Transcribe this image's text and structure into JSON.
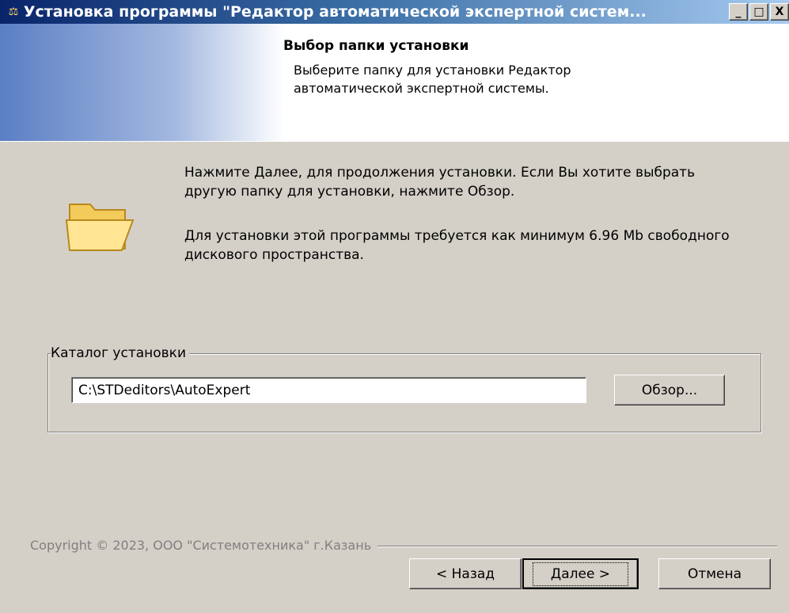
{
  "window": {
    "title": "Установка программы \"Редактор автоматической экспертной систем...",
    "icon": "scales-icon",
    "controls": {
      "minimize": "_",
      "maximize": "□",
      "close": "X"
    }
  },
  "header": {
    "title": "Выбор папки установки",
    "description": "Выберите папку для установки Редактор автоматической экспертной системы."
  },
  "body": {
    "message1": "Нажмите Далее, для продолжения установки. Если Вы хотите выбрать другую папку для установки, нажмите Обзор.",
    "message2": "Для установки этой программы требуется как минимум 6.96 Mb свободного дискового пространства."
  },
  "install_dir": {
    "label": "Каталог установки",
    "value": "C:\\STDeditors\\AutoExpert",
    "browse_label": "Обзор..."
  },
  "footer": {
    "copyright": "Copyright © 2023, ООО \"Системотехника\" г.Казань",
    "back_label": "< Назад",
    "next_label": "Далее >",
    "cancel_label": "Отмена"
  }
}
